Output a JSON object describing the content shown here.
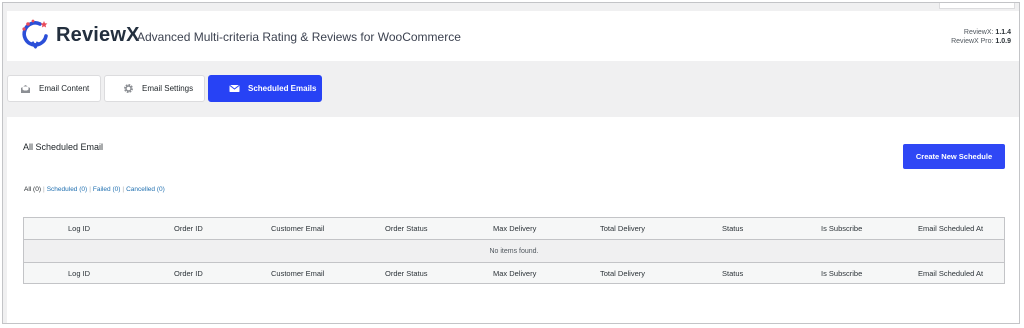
{
  "header": {
    "brand": "ReviewX",
    "tagline": "Advanced Multi-criteria Rating & Reviews for WooCommerce",
    "version_label": "ReviewX:",
    "version_value": "1.1.4",
    "pro_label": "ReviewX Pro:",
    "pro_value": "1.0.9"
  },
  "tabs": [
    {
      "label": "Email Content",
      "icon": "envelope-open-icon"
    },
    {
      "label": "Email Settings",
      "icon": "gear-icon"
    },
    {
      "label": "Scheduled Emails",
      "icon": "envelope-icon",
      "active": true
    }
  ],
  "panel": {
    "title": "All Scheduled Email",
    "create_button": "Create New Schedule"
  },
  "filters": [
    {
      "label": "All",
      "count": "(0)"
    },
    {
      "label": "Scheduled",
      "count": "(0)"
    },
    {
      "label": "Failed",
      "count": "(0)"
    },
    {
      "label": "Cancelled",
      "count": "(0)"
    }
  ],
  "table": {
    "columns": [
      "Log ID",
      "Order ID",
      "Customer Email",
      "Order Status",
      "Max Delivery",
      "Total Delivery",
      "Status",
      "Is Subscribe",
      "Email Scheduled At"
    ],
    "empty_message": "No items found."
  },
  "colors": {
    "accent": "#2742f5",
    "link": "#2271b1",
    "logo_blue": "#2b4fd8",
    "logo_red": "#e94b5a"
  }
}
